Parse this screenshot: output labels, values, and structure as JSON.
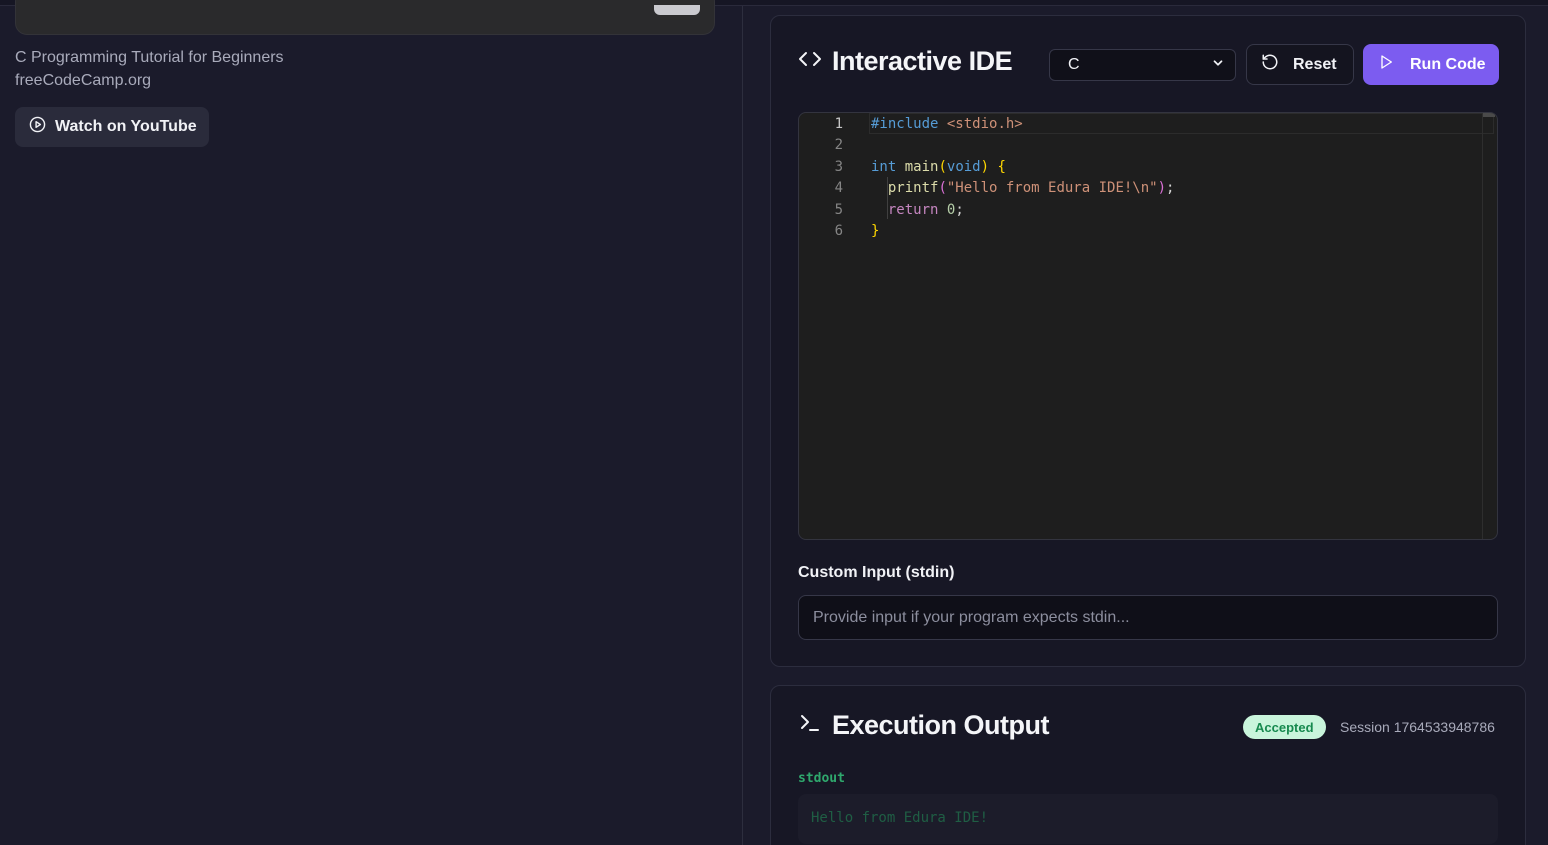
{
  "video": {
    "title": "C Programming Tutorial for Beginners",
    "channel": "freeCodeCamp.org",
    "watch_label": "Watch on YouTube"
  },
  "ide": {
    "title": "Interactive IDE",
    "language": "C",
    "reset_label": "Reset",
    "run_label": "Run Code",
    "code_lines": [
      "#include <stdio.h>",
      "",
      "int main(void) {",
      "  printf(\"Hello from Edura IDE!\\n\");",
      "  return 0;",
      "}"
    ],
    "line_numbers": [
      "1",
      "2",
      "3",
      "4",
      "5",
      "6"
    ],
    "stdin_label": "Custom Input (stdin)",
    "stdin_placeholder": "Provide input if your program expects stdin...",
    "stdin_value": ""
  },
  "output": {
    "title": "Execution Output",
    "status": "Accepted",
    "session": "Session 1764533948786",
    "stdout_label": "stdout",
    "stdout_text": "Hello from Edura IDE!"
  },
  "colors": {
    "accent": "#7c5cf0",
    "success_bg": "#c9f5dc",
    "success_text": "#178a4f",
    "background": "#1b1b2b"
  },
  "icons": {
    "watch": "play-circle-icon",
    "ide": "code-brackets-icon",
    "select": "chevron-down-icon",
    "reset": "rotate-ccw-icon",
    "run": "play-icon",
    "output": "terminal-icon"
  }
}
